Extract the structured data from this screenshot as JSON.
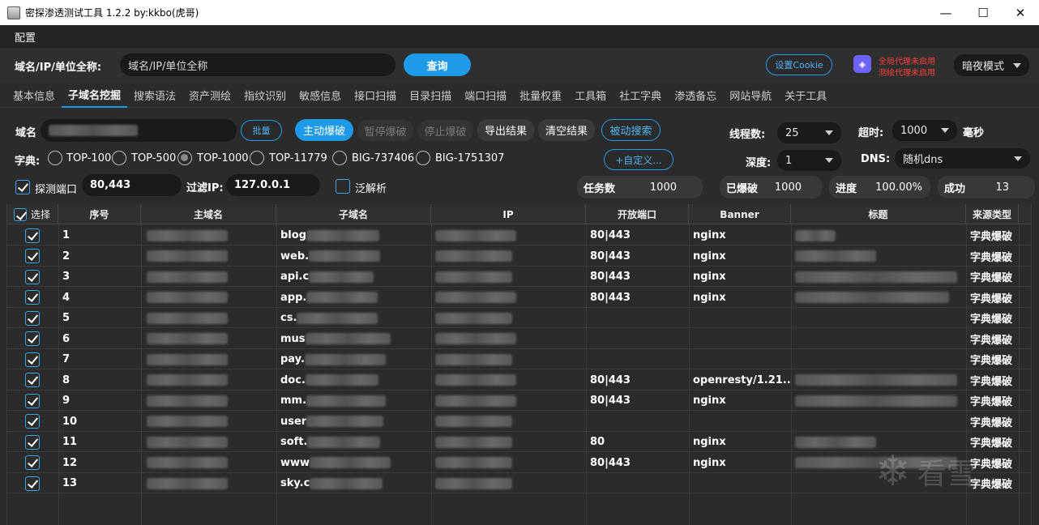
{
  "window": {
    "title": "密探渗透测试工具 1.2.2 by:kkbo(虎哥)",
    "min": "—",
    "max": "☐",
    "close": "✕"
  },
  "menu": {
    "config": "配置"
  },
  "top": {
    "label": "域名/IP/单位全称:",
    "search_value": "域名/IP/单位全称",
    "query": "查询",
    "cookie": "设置Cookie",
    "proxy_global": "全局代理未启用",
    "proxy_test": "测绘代理未启用",
    "theme": "暗夜模式"
  },
  "tabs": [
    "基本信息",
    "子域名挖掘",
    "搜索语法",
    "资产测绘",
    "指纹识别",
    "敏感信息",
    "接口扫描",
    "目录扫描",
    "端口扫描",
    "批量权重",
    "工具箱",
    "社工字典",
    "渗透备忘",
    "网站导航",
    "关于工具"
  ],
  "controls": {
    "domain_label": "域名",
    "batch": "批量",
    "active": "主动爆破",
    "pause": "暂停爆破",
    "stop": "停止爆破",
    "export": "导出结果",
    "clear": "清空结果",
    "passive": "被动搜索",
    "threads_label": "线程数:",
    "threads_value": "25",
    "timeout_label": "超时:",
    "timeout_value": "1000",
    "ms": "毫秒",
    "dict_label": "字典:",
    "dicts": [
      "TOP-100",
      "TOP-500",
      "TOP-1000",
      "TOP-11779",
      "BIG-737406",
      "BIG-1751307"
    ],
    "custom": "+自定义...",
    "depth_label": "深度:",
    "depth_value": "1",
    "dns_label": "DNS:",
    "dns_value": "随机dns",
    "probe_label": "探测端口",
    "ports_value": "80,443",
    "filter_label": "过滤IP:",
    "filter_value": "127.0.0.1",
    "wildcard_label": "泛解析",
    "task_label": "任务数",
    "task_value": "1000",
    "cracked_label": "已爆破",
    "cracked_value": "1000",
    "progress_label": "进度",
    "progress_value": "100.00%",
    "success_label": "成功",
    "success_value": "13"
  },
  "table": {
    "headers": [
      "选择",
      "序号",
      "主域名",
      "子域名",
      "IP",
      "开放端口",
      "Banner",
      "标题",
      "来源类型"
    ],
    "rows": [
      {
        "n": "1",
        "sub": "blog",
        "port": "80|443",
        "banner": "nginx",
        "src": "字典爆破"
      },
      {
        "n": "2",
        "sub": "web.",
        "port": "80|443",
        "banner": "nginx",
        "src": "字典爆破"
      },
      {
        "n": "3",
        "sub": "api.c",
        "port": "80|443",
        "banner": "nginx",
        "src": "字典爆破"
      },
      {
        "n": "4",
        "sub": "app.",
        "port": "80|443",
        "banner": "nginx",
        "src": "字典爆破"
      },
      {
        "n": "5",
        "sub": "cs.",
        "port": "",
        "banner": "",
        "src": "字典爆破"
      },
      {
        "n": "6",
        "sub": "mus",
        "port": "",
        "banner": "",
        "src": "字典爆破"
      },
      {
        "n": "7",
        "sub": "pay.",
        "port": "",
        "banner": "",
        "src": "字典爆破"
      },
      {
        "n": "8",
        "sub": "doc.",
        "port": "80|443",
        "banner": "openresty/1.21....",
        "src": "字典爆破"
      },
      {
        "n": "9",
        "sub": "mm.",
        "port": "80|443",
        "banner": "nginx",
        "src": "字典爆破"
      },
      {
        "n": "10",
        "sub": "user",
        "port": "",
        "banner": "",
        "src": "字典爆破"
      },
      {
        "n": "11",
        "sub": "soft.",
        "port": "80",
        "banner": "nginx",
        "src": "字典爆破"
      },
      {
        "n": "12",
        "sub": "www",
        "port": "80|443",
        "banner": "nginx",
        "src": "字典爆破"
      },
      {
        "n": "13",
        "sub": "sky.c",
        "port": "",
        "banner": "",
        "src": "字典爆破"
      }
    ]
  },
  "watermark": "看雪",
  "colors": {
    "accent": "#1e9be8",
    "bg": "#2b2b2b",
    "proxy_warn": "#ff3b3b"
  }
}
